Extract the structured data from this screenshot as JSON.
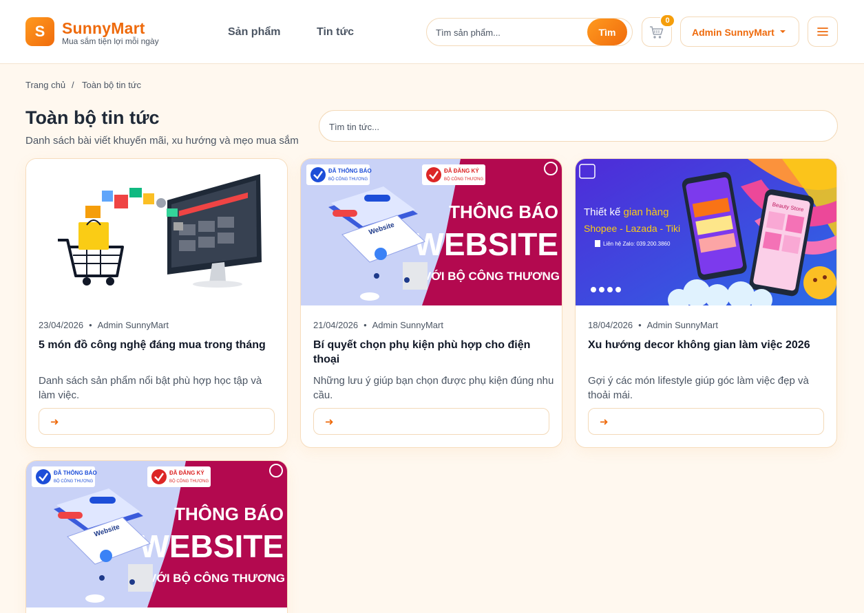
{
  "header": {
    "logo_letter": "S",
    "brand_name": "SunnyMart",
    "brand_tagline": "Mua sắm tiện lợi mỗi ngày",
    "nav": [
      "Sản phẩm",
      "Tin tức"
    ],
    "search_placeholder": "Tìm sản phẩm...",
    "search_button": "Tìm",
    "cart_count": "0",
    "user_name": "Admin SunnyMart",
    "accent_color": "#ee6a0c"
  },
  "breadcrumb": {
    "home": "Trang chủ",
    "separator": "/",
    "current": "Toàn bộ tin tức"
  },
  "page": {
    "title": "Toàn bộ tin tức",
    "subtitle": "Danh sách bài viết khuyến mãi, xu hướng và mẹo mua sắm",
    "search_placeholder": "Tìm tin tức..."
  },
  "banners": {
    "notice_badge_1": "ĐÃ THÔNG BÁO",
    "notice_badge_1_sub": "BỘ CÔNG THƯƠNG",
    "notice_badge_2": "ĐÃ ĐĂNG KÝ",
    "notice_badge_2_sub": "BỘ CÔNG THƯƠNG",
    "notice_line1": "THÔNG BÁO",
    "notice_line2": "WEBSITE",
    "notice_line3": "VỚI BỘ CÔNG THƯƠNG",
    "notice_screen_label": "Website",
    "shop_line1a": "Thiết kế ",
    "shop_line1b": "gian hàng",
    "shop_line2": "Shopee - Lazada - Tiki",
    "shop_line3": "Liên hệ Zalo: 039.200.3860",
    "shop_store_label": "Beauty Store"
  },
  "articles": [
    {
      "date": "23/04/2026",
      "author": "Admin SunnyMart",
      "title": "5 món đồ công nghệ đáng mua trong tháng",
      "desc": "Danh sách sản phẩm nổi bật phù hợp học tập và làm việc.",
      "image": "shopping-cart-computer",
      "cta": "➜"
    },
    {
      "date": "21/04/2026",
      "author": "Admin SunnyMart",
      "title": "Bí quyết chọn phụ kiện phù hợp cho điện thoại",
      "desc": "Những lưu ý giúp bạn chọn được phụ kiện đúng nhu cầu.",
      "image": "website-notice-banner",
      "cta": "➜"
    },
    {
      "date": "18/04/2026",
      "author": "Admin SunnyMart",
      "title": "Xu hướng decor không gian làm việc 2026",
      "desc": "Gợi ý các món lifestyle giúp góc làm việc đẹp và thoải mái.",
      "image": "shop-design-banner",
      "cta": "➜"
    },
    {
      "image": "website-notice-banner"
    }
  ]
}
